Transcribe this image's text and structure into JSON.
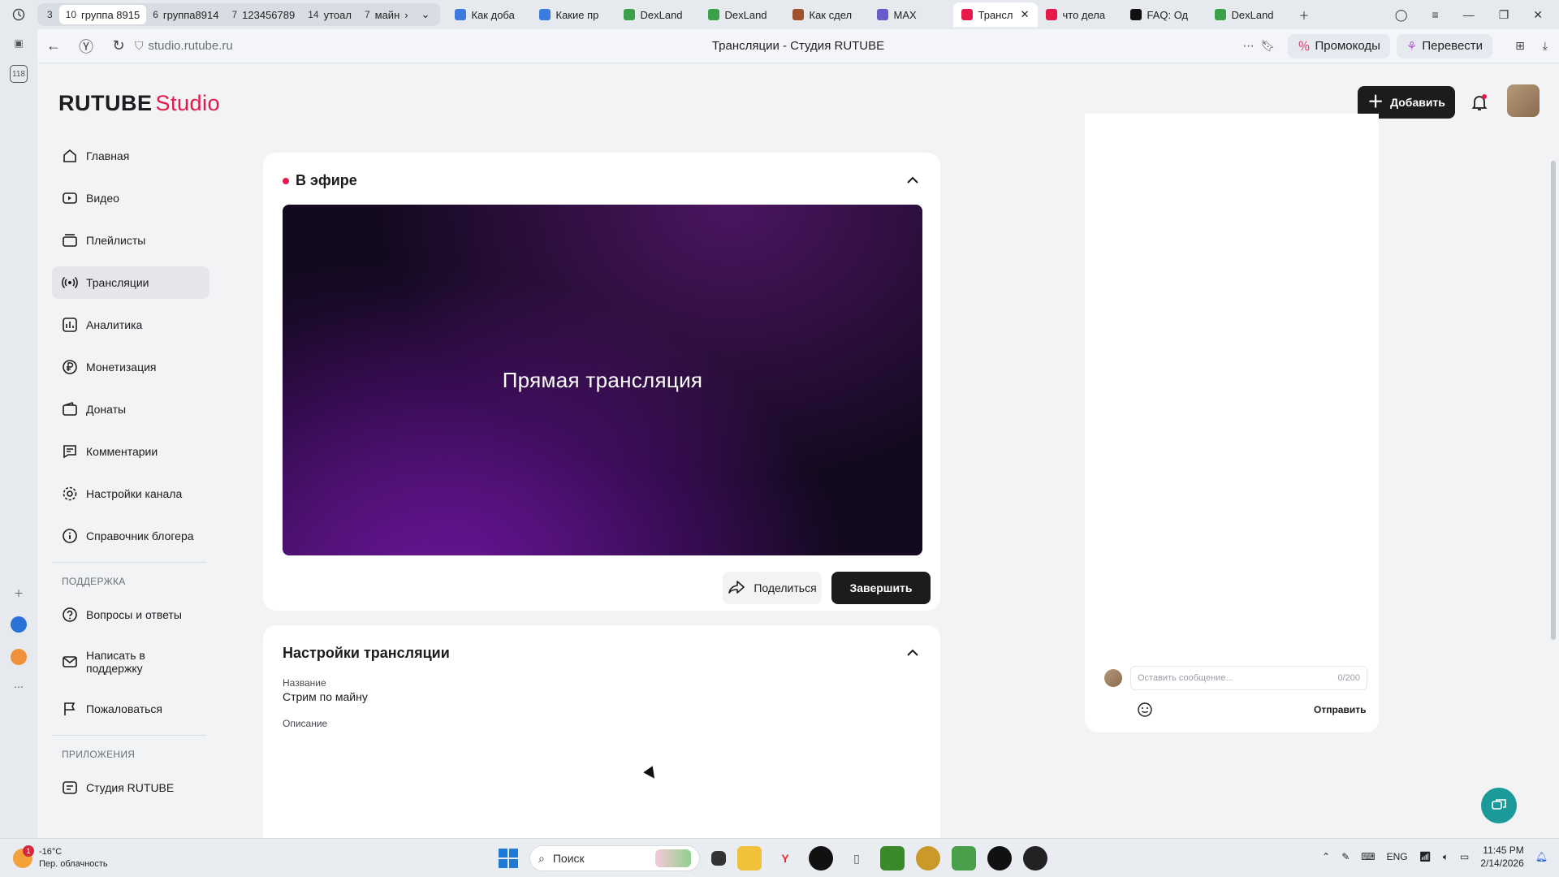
{
  "browser": {
    "tab_groups": [
      {
        "num": "3",
        "label": ""
      },
      {
        "num": "10",
        "label": "группа 8915",
        "active": true
      },
      {
        "num": "6",
        "label": "группа8914"
      },
      {
        "num": "7",
        "label": "123456789"
      },
      {
        "num": "14",
        "label": "утоал"
      },
      {
        "num": "7",
        "label": "майн"
      }
    ],
    "tabs": [
      {
        "label": "Как доба",
        "color": "#3b7be0"
      },
      {
        "label": "Какие пр",
        "color": "#3b7be0"
      },
      {
        "label": "DexLand",
        "color": "#3aa14a"
      },
      {
        "label": "DexLand",
        "color": "#3aa14a"
      },
      {
        "label": "Как сдел",
        "color": "#a0522d"
      },
      {
        "label": "MAX",
        "color": "#6a5acd"
      },
      {
        "label": "Трансл",
        "color": "#e6194b",
        "active": true
      },
      {
        "label": "что дела",
        "color": "#e6194b"
      },
      {
        "label": "FAQ: Од",
        "color": "#111111"
      },
      {
        "label": "DexLand",
        "color": "#3aa14a"
      }
    ],
    "url": "studio.rutube.ru",
    "page_title": "Трансляции - Студия RUTUBE",
    "promo_label": "Промокоды",
    "translate_label": "Перевести",
    "rail_badge": "118"
  },
  "header": {
    "logo_main": "RUTUBE",
    "logo_sub": "Studio",
    "add_label": "Добавить"
  },
  "sidebar": {
    "items": [
      {
        "label": "Главная",
        "icon": "home-icon"
      },
      {
        "label": "Видео",
        "icon": "video-icon"
      },
      {
        "label": "Плейлисты",
        "icon": "playlist-icon"
      },
      {
        "label": "Трансляции",
        "icon": "broadcast-icon",
        "active": true
      },
      {
        "label": "Аналитика",
        "icon": "analytics-icon"
      },
      {
        "label": "Монетизация",
        "icon": "ruble-icon"
      },
      {
        "label": "Донаты",
        "icon": "wallet-icon"
      },
      {
        "label": "Комментарии",
        "icon": "comment-icon"
      },
      {
        "label": "Настройки канала",
        "icon": "gear-icon"
      },
      {
        "label": "Справочник блогера",
        "icon": "info-icon"
      }
    ],
    "support_label": "ПОДДЕРЖКА",
    "support_items": [
      {
        "label": "Вопросы и ответы",
        "icon": "question-icon"
      },
      {
        "label": "Написать в поддержку",
        "icon": "mail-icon"
      },
      {
        "label": "Пожаловаться",
        "icon": "flag-icon"
      }
    ],
    "apps_label": "ПРИЛОЖЕНИЯ",
    "apps_items": [
      {
        "label": "Студия RUTUBE",
        "icon": "studio-icon"
      }
    ]
  },
  "live": {
    "status": "В эфире",
    "player_title": "Прямая трансляция",
    "share_label": "Поделиться",
    "end_label": "Завершить"
  },
  "settings": {
    "title": "Настройки трансляции",
    "name_label": "Название",
    "name_value": "Стрим по майну",
    "desc_label": "Описание"
  },
  "chat": {
    "placeholder": "Оставить сообщение...",
    "counter": "0/200",
    "send_label": "Отправить"
  },
  "taskbar": {
    "temp": "-16°C",
    "weather": "Пер. облачность",
    "weather_badge": "1",
    "search_label": "Поиск",
    "lang": "ENG",
    "time": "11:45 PM",
    "date": "2/14/2026"
  }
}
